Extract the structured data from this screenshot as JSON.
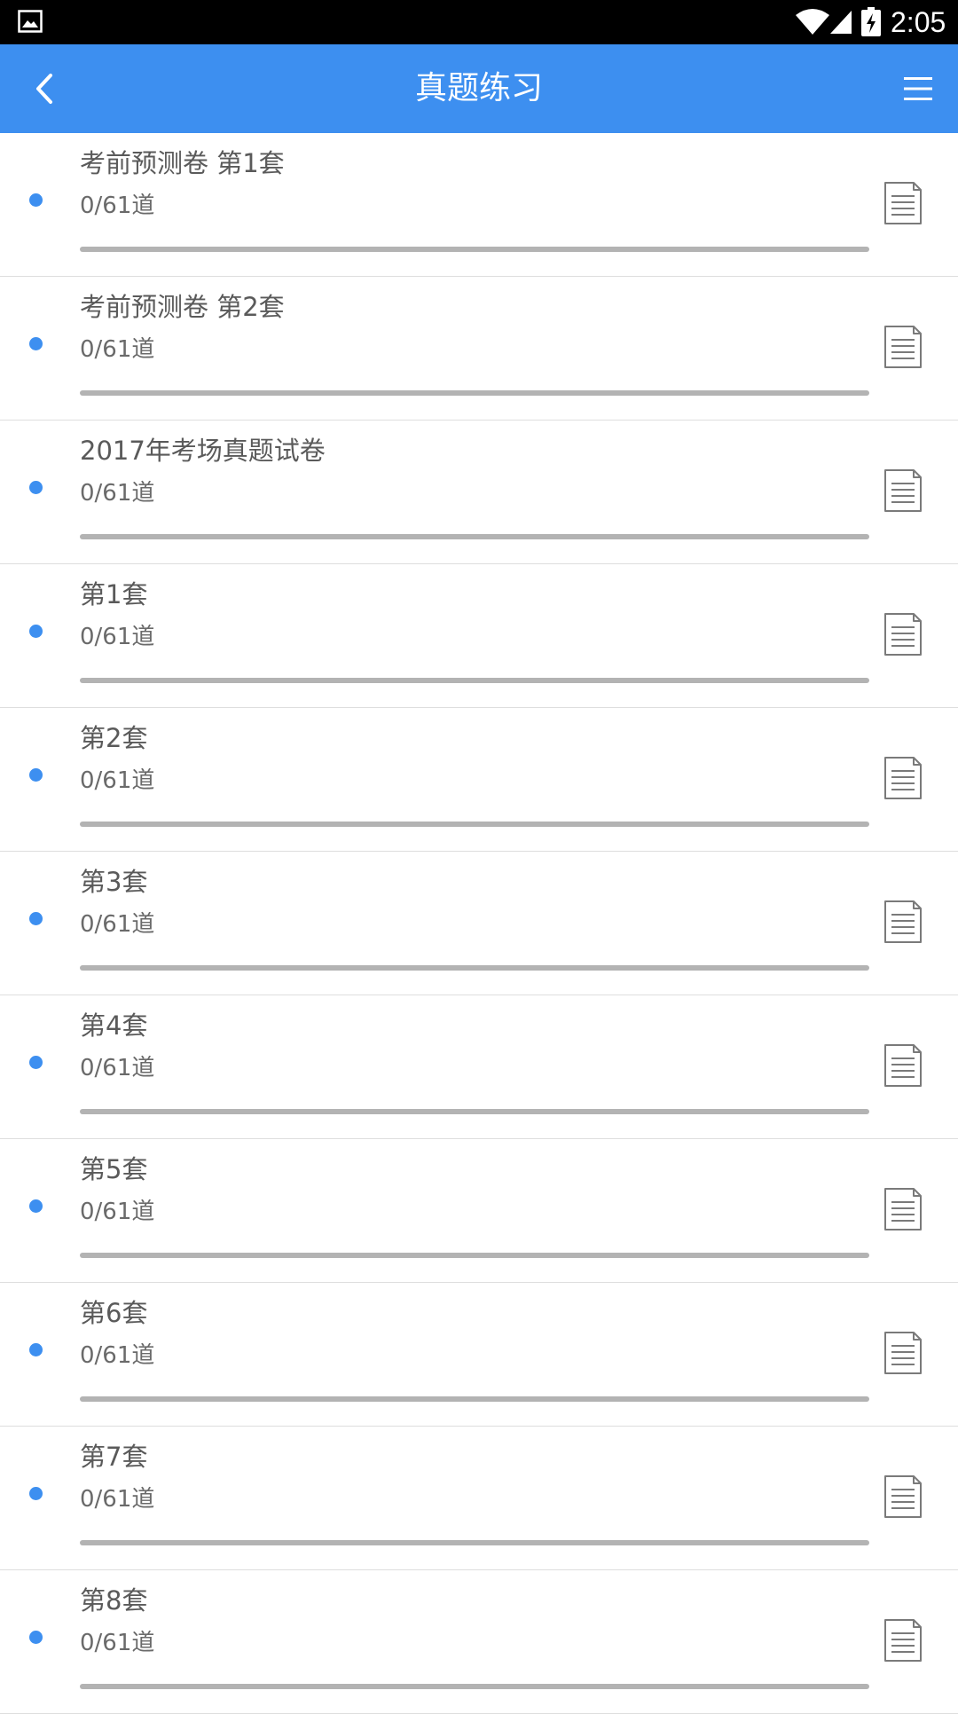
{
  "status_bar": {
    "time": "2:05",
    "icons": [
      "gallery-icon",
      "wifi-icon",
      "signal-icon",
      "battery-charging-icon"
    ]
  },
  "app_bar": {
    "title": "真题练习",
    "back_icon": "chevron-left-icon",
    "menu_icon": "menu-icon"
  },
  "colors": {
    "accent": "#3d8ff0",
    "progress_track": "#b3b3b3",
    "status_bar": "#000000"
  },
  "papers": [
    {
      "title": "考前预测卷 第1套",
      "count": "0/61道",
      "progress": 0
    },
    {
      "title": "考前预测卷 第2套",
      "count": "0/61道",
      "progress": 0
    },
    {
      "title": "2017年考场真题试卷",
      "count": "0/61道",
      "progress": 0
    },
    {
      "title": "第1套",
      "count": "0/61道",
      "progress": 0
    },
    {
      "title": "第2套",
      "count": "0/61道",
      "progress": 0
    },
    {
      "title": "第3套",
      "count": "0/61道",
      "progress": 0
    },
    {
      "title": "第4套",
      "count": "0/61道",
      "progress": 0
    },
    {
      "title": "第5套",
      "count": "0/61道",
      "progress": 0
    },
    {
      "title": "第6套",
      "count": "0/61道",
      "progress": 0
    },
    {
      "title": "第7套",
      "count": "0/61道",
      "progress": 0
    },
    {
      "title": "第8套",
      "count": "0/61道",
      "progress": 0
    }
  ],
  "row_icon": "document-icon"
}
